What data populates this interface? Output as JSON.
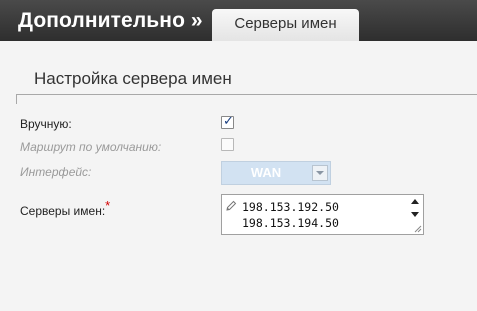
{
  "header": {
    "title": "Дополнительно »",
    "tab_label": "Серверы имен"
  },
  "section": {
    "title": "Настройка сервера имен"
  },
  "form": {
    "manual": {
      "label": "Вручную:",
      "checked": true
    },
    "default_route": {
      "label": "Маршрут по умолчанию:",
      "checked": false,
      "disabled": true
    },
    "interface": {
      "label": "Интерфейс:",
      "value": "WAN",
      "disabled": true
    },
    "dns_servers": {
      "label": "Серверы имен:",
      "required_mark": "*",
      "lines": [
        "198.153.192.50",
        "198.153.194.50"
      ]
    }
  },
  "icons": {
    "checkbox_tick": "check-icon",
    "edit": "pencil-icon",
    "select": "chevron-down-icon"
  },
  "colors": {
    "header_bg": "#3a3a3a",
    "select_bg": "#d2e2f2",
    "required": "#d40000"
  }
}
